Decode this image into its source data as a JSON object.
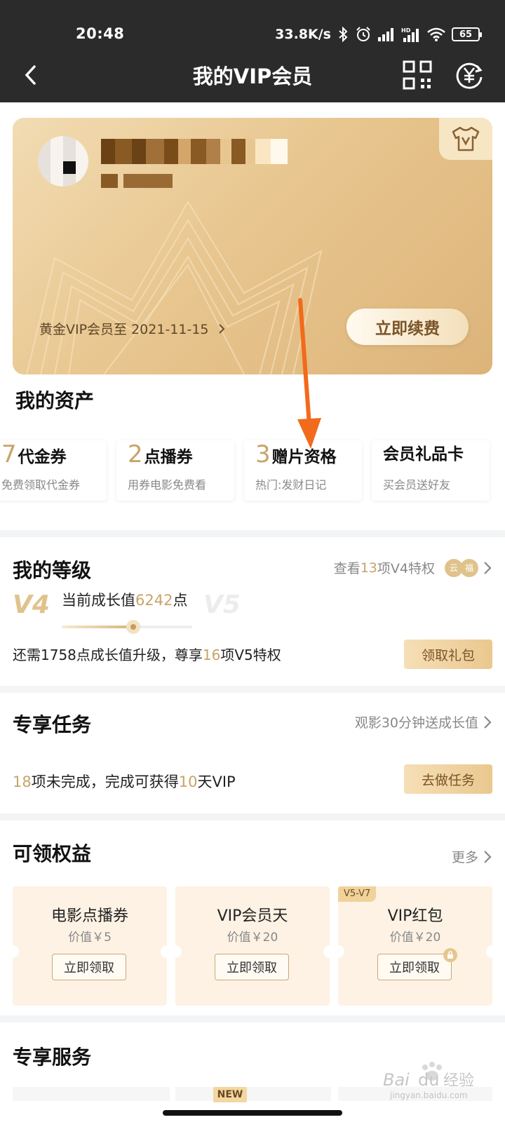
{
  "status_bar": {
    "time": "20:48",
    "net_speed": "33.8K/s",
    "battery": "65"
  },
  "nav": {
    "title": "我的VIP会员",
    "back_icon": "chevron-left-icon",
    "qr_icon": "qr-code-icon",
    "coin_icon": "yuan-refresh-icon"
  },
  "vip_card": {
    "expire_text": "黄金VIP会员至 2021-11-15",
    "renew_label": "立即续费",
    "badge_icon": "tshirt-v-icon"
  },
  "assets": {
    "title": "我的资产",
    "items": [
      {
        "num": "7",
        "label": "代金券",
        "sub": "免费领取代金券"
      },
      {
        "num": "2",
        "label": "点播券",
        "sub": "用券电影免费看"
      },
      {
        "num": "3",
        "label": "赠片资格",
        "sub": "热门:发财日记"
      },
      {
        "num": "",
        "label": "会员礼品卡",
        "sub": "买会员送好友"
      }
    ]
  },
  "level": {
    "title": "我的等级",
    "link_prefix": "查看",
    "link_count": "13",
    "link_suffix": "项V4特权",
    "current_level": "V4",
    "next_level": "V5",
    "growth_prefix": "当前成长值",
    "growth_value": "6242",
    "growth_suffix": "点",
    "progress_fraction": 0.55,
    "upgrade_prefix": "还需1758点成长值升级，尊享",
    "upgrade_count": "16",
    "upgrade_suffix": "项V5特权",
    "button_label": "领取礼包",
    "coin_a": "云",
    "coin_b": "福"
  },
  "tasks": {
    "title": "专享任务",
    "link_label": "观影30分钟送成长值",
    "count": "18",
    "mid_text": "项未完成，完成可获得",
    "days": "10",
    "suffix": "天VIP",
    "button_label": "去做任务"
  },
  "benefits": {
    "title": "可领权益",
    "more_label": "更多",
    "items": [
      {
        "title": "电影点播券",
        "price": "价值￥5",
        "button": "立即领取",
        "badge": ""
      },
      {
        "title": "VIP会员天",
        "price": "价值￥20",
        "button": "立即领取",
        "badge": ""
      },
      {
        "title": "VIP红包",
        "price": "价值￥20",
        "button": "立即领取",
        "badge": "V5-V7"
      }
    ]
  },
  "services": {
    "title": "专享服务",
    "new_badge": "NEW"
  },
  "watermark": {
    "brand": "Baidu经验",
    "url": "jingyan.baidu.com"
  },
  "colors": {
    "gold": "#c8a469",
    "card_gold": "#e8c68f",
    "annotation_arrow": "#f26a1b"
  }
}
